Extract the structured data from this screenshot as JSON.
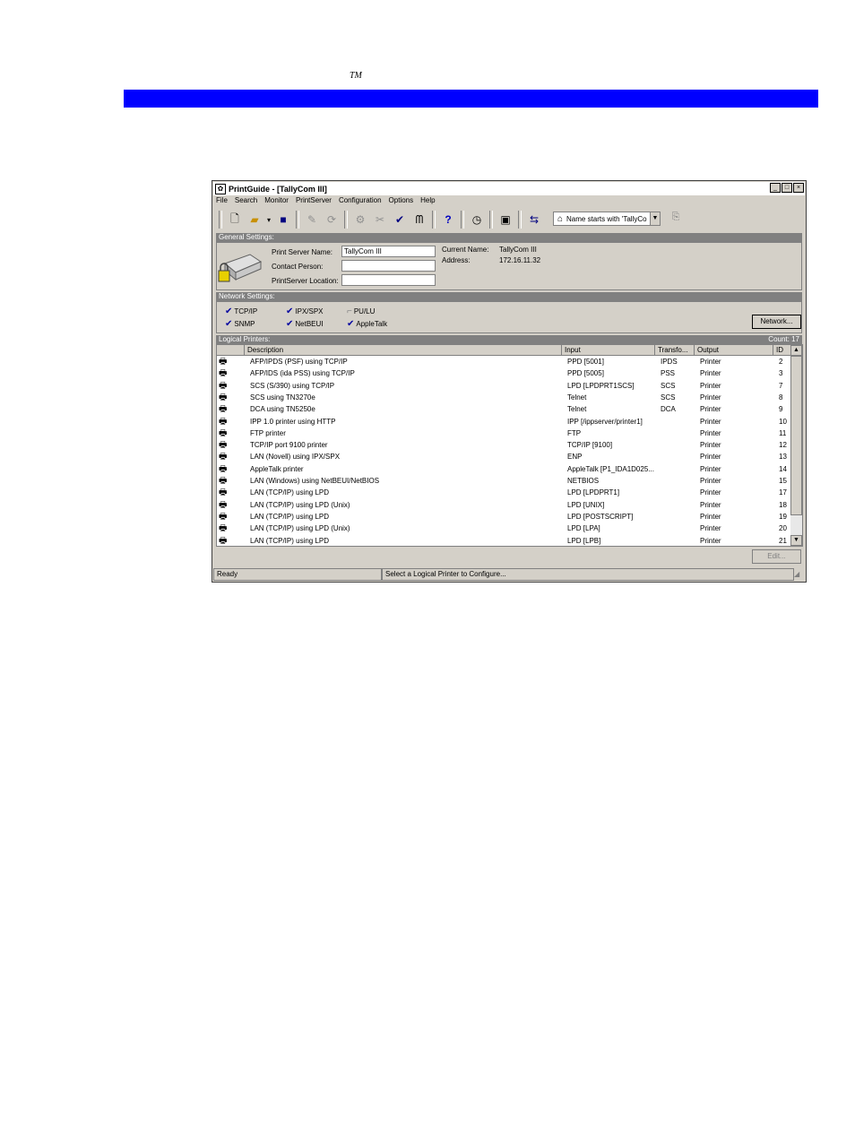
{
  "page": {
    "tm_mark": "TM"
  },
  "window": {
    "title": "PrintGuide - [TallyCom III]",
    "controls": [
      "_",
      "□",
      "×"
    ],
    "menu": [
      "File",
      "Search",
      "Monitor",
      "PrintServer",
      "Configuration",
      "Options",
      "Help"
    ],
    "toolbar_icons": [
      "new-file-icon",
      "open-folder-icon",
      "dropdown-arrow-icon",
      "save-icon",
      "pointer-icon",
      "refresh-icon",
      "configure-icon",
      "tools-icon",
      "wrench-icon",
      "binoculars-icon",
      "help-icon",
      "clock-icon",
      "monitor-icon",
      "filter-icon"
    ],
    "filter": {
      "value": "Name starts with 'TallyCo"
    }
  },
  "general_settings": {
    "header": "General Settings",
    "print_server_name_label": "Print Server Name:",
    "print_server_name_value": "TallyCom III",
    "contact_person_label": "Contact Person:",
    "contact_person_value": "",
    "location_label": "PrintServer Location:",
    "location_value": "",
    "current_name_label": "Current Name:",
    "current_name_value": "TallyCom III",
    "address_label": "Address:",
    "address_value": "172.16.11.32"
  },
  "network_settings": {
    "header": "Network Settings",
    "protocols": [
      {
        "label": "TCP/IP",
        "enabled": true
      },
      {
        "label": "IPX/SPX",
        "enabled": true
      },
      {
        "label": "PU/LU",
        "enabled": false
      },
      {
        "label": "SNMP",
        "enabled": true
      },
      {
        "label": "NetBEUI",
        "enabled": true
      },
      {
        "label": "AppleTalk",
        "enabled": true
      }
    ],
    "network_button": "Network..."
  },
  "logical_printers": {
    "header": "Logical Printers",
    "count": "Count: 17",
    "columns": [
      "Description",
      "Input",
      "Transfo...",
      "Output",
      "ID"
    ],
    "rows": [
      [
        "AFP/IPDS (PSF) using TCP/IP",
        "PPD [5001]",
        "IPDS",
        "Printer",
        "2"
      ],
      [
        "AFP/IDS (ida PSS) using TCP/IP",
        "PPD [5005]",
        "PSS",
        "Printer",
        "3"
      ],
      [
        "SCS (S/390) using TCP/IP",
        "LPD [LPDPRT1SCS]",
        "SCS",
        "Printer",
        "7"
      ],
      [
        "SCS using TN3270e",
        "Telnet",
        "SCS",
        "Printer",
        "8"
      ],
      [
        "DCA using TN5250e",
        "Telnet",
        "DCA",
        "Printer",
        "9"
      ],
      [
        "IPP 1.0 printer using HTTP",
        "IPP [/ippserver/printer1]",
        "",
        "Printer",
        "10"
      ],
      [
        "FTP printer",
        "FTP",
        "",
        "Printer",
        "11"
      ],
      [
        "TCP/IP port 9100 printer",
        "TCP/IP [9100]",
        "",
        "Printer",
        "12"
      ],
      [
        "LAN (Novell) using IPX/SPX",
        "ENP",
        "",
        "Printer",
        "13"
      ],
      [
        "AppleTalk printer",
        "AppleTalk [P1_IDA1D025...",
        "",
        "Printer",
        "14"
      ],
      [
        "LAN (Windows) using NetBEUI/NetBIOS",
        "NETBIOS",
        "",
        "Printer",
        "15"
      ],
      [
        "LAN (TCP/IP) using LPD",
        "LPD [LPDPRT1]",
        "",
        "Printer",
        "17"
      ],
      [
        "LAN (TCP/IP) using LPD (Unix)",
        "LPD [UNIX]",
        "",
        "Printer",
        "18"
      ],
      [
        "LAN (TCP/IP) using LPD",
        "LPD [POSTSCRIPT]",
        "",
        "Printer",
        "19"
      ],
      [
        "LAN (TCP/IP) using LPD (Unix)",
        "LPD [LPA]",
        "",
        "Printer",
        "20"
      ],
      [
        "LAN (TCP/IP) using LPD",
        "LPD [LPB]",
        "",
        "Printer",
        "21"
      ]
    ],
    "edit_button": "Edit..."
  },
  "status": {
    "left": "Ready",
    "right": "Select a Logical Printer to Configure..."
  }
}
